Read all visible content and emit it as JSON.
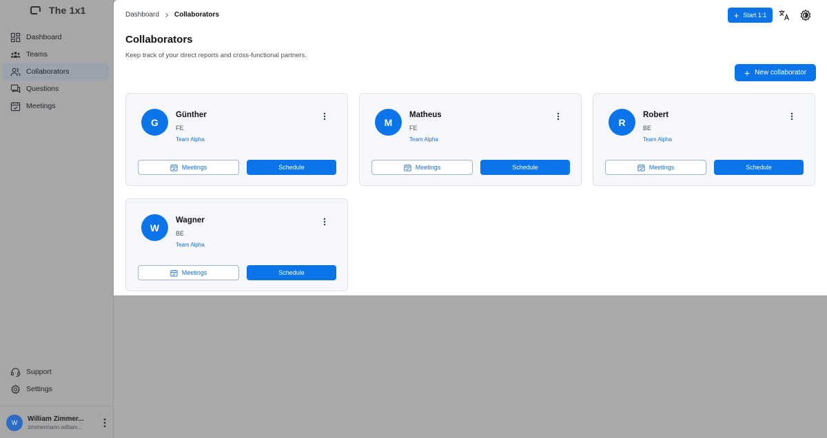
{
  "app": {
    "name": "The 1x1"
  },
  "sidebar": {
    "items": [
      {
        "label": "Dashboard",
        "icon": "dashboard-icon",
        "active": false
      },
      {
        "label": "Teams",
        "icon": "teams-icon",
        "active": false
      },
      {
        "label": "Collaborators",
        "icon": "collaborators-icon",
        "active": true
      },
      {
        "label": "Questions",
        "icon": "questions-icon",
        "active": false
      },
      {
        "label": "Meetings",
        "icon": "calendar-check-icon",
        "active": false
      }
    ],
    "bottom_items": [
      {
        "label": "Support",
        "icon": "support-icon"
      },
      {
        "label": "Settings",
        "icon": "gear-icon"
      }
    ],
    "user": {
      "initial": "W",
      "name": "William Zimmer...",
      "email": "zimmermann.william..."
    }
  },
  "header": {
    "breadcrumb": {
      "home": "Dashboard",
      "current": "Collaborators"
    },
    "start_label": "Start 1:1",
    "translate_icon": "translate-icon",
    "theme_icon": "theme-icon"
  },
  "page": {
    "title": "Collaborators",
    "subtitle": "Keep track of your direct reports and cross-functional partners.",
    "new_button": "New collaborator"
  },
  "collaborators": [
    {
      "initial": "G",
      "name": "Günther",
      "role": "FE",
      "team": "Team Alpha",
      "meetings_label": "Meetings",
      "schedule_label": "Schedule"
    },
    {
      "initial": "M",
      "name": "Matheus",
      "role": "FE",
      "team": "Team Alpha",
      "meetings_label": "Meetings",
      "schedule_label": "Schedule"
    },
    {
      "initial": "R",
      "name": "Robert",
      "role": "BE",
      "team": "Team Alpha",
      "meetings_label": "Meetings",
      "schedule_label": "Schedule"
    },
    {
      "initial": "W",
      "name": "Wagner",
      "role": "BE",
      "team": "Team Alpha",
      "meetings_label": "Meetings",
      "schedule_label": "Schedule"
    }
  ],
  "colors": {
    "accent": "#0a74e8",
    "sidebar_bg": "#a7a7a7",
    "active_item_bg": "#9aa3ae",
    "card_bg": "#f5f7fa",
    "link": "#1c6fd1"
  }
}
